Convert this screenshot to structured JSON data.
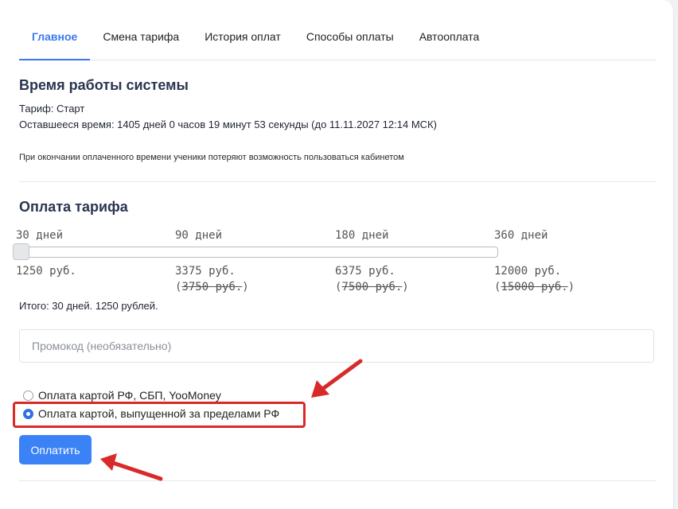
{
  "tabs": [
    {
      "label": "Главное",
      "active": true
    },
    {
      "label": "Смена тарифа",
      "active": false
    },
    {
      "label": "История оплат",
      "active": false
    },
    {
      "label": "Способы оплаты",
      "active": false
    },
    {
      "label": "Автооплата",
      "active": false
    }
  ],
  "system": {
    "title": "Время работы системы",
    "tariff": "Тариф: Старт",
    "remaining": "Оставшееся время: 1405 дней 0 часов 19 минут 53 секунды (до 11.11.2027 12:14 МСК)",
    "note": "При окончании оплаченного времени ученики потеряют возможность пользоваться кабинетом"
  },
  "payment": {
    "title": "Оплата тарифа",
    "periods": [
      {
        "label": "30 дней",
        "price": "1250 руб.",
        "old_price": ""
      },
      {
        "label": "90 дней",
        "price": "3375 руб.",
        "old_price": "3750 руб."
      },
      {
        "label": "180 дней",
        "price": "6375 руб.",
        "old_price": "7500 руб."
      },
      {
        "label": "360 дней",
        "price": "12000 руб.",
        "old_price": "15000 руб."
      }
    ],
    "slider_selected_index": 0,
    "total": "Итого: 30 дней. 1250 рублей.",
    "promo_placeholder": "Промокод (необязательно)",
    "methods": [
      {
        "label": "Оплата картой РФ, СБП, YooMoney",
        "checked": false
      },
      {
        "label": "Оплата картой, выпущенной за пределами РФ",
        "checked": true
      }
    ],
    "pay_label": "Оплатить"
  },
  "colors": {
    "accent": "#3a78f2",
    "button": "#3b82f6",
    "annotation": "#d92a2a"
  }
}
